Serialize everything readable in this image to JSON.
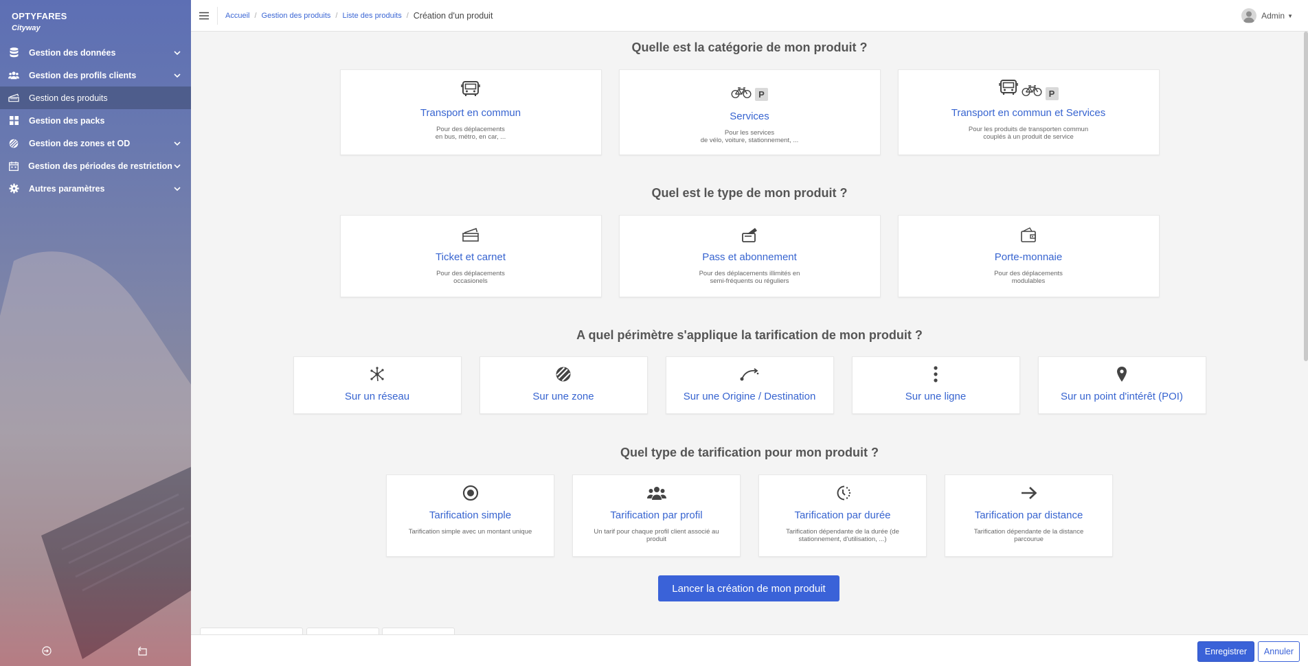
{
  "brand": {
    "name": "OPTYFARES",
    "subtitle": "Cityway"
  },
  "sidebar": {
    "items": [
      {
        "label": "Gestion des données",
        "icon": "database-icon",
        "expandable": true
      },
      {
        "label": "Gestion des profils clients",
        "icon": "users-icon",
        "expandable": true
      },
      {
        "label": "Gestion des produits",
        "icon": "tickets-icon",
        "expandable": false,
        "active": true
      },
      {
        "label": "Gestion des packs",
        "icon": "grid-icon",
        "expandable": false
      },
      {
        "label": "Gestion des zones et OD",
        "icon": "zone-icon",
        "expandable": true
      },
      {
        "label": "Gestion des périodes de restriction",
        "icon": "calendar-icon",
        "expandable": true
      },
      {
        "label": "Autres paramètres",
        "icon": "gear-icon",
        "expandable": true
      }
    ],
    "bottom_icons": [
      "logout-icon",
      "switch-icon"
    ]
  },
  "breadcrumb": {
    "items": [
      "Accueil",
      "Gestion des produits",
      "Liste des produits"
    ],
    "current": "Création d'un produit"
  },
  "user": {
    "name": "Admin"
  },
  "sections": {
    "category": {
      "title": "Quelle est la catégorie de mon produit ?",
      "cards": [
        {
          "title": "Transport en commun",
          "desc": "Pour des déplacements\nen bus, métro, en car, ..."
        },
        {
          "title": "Services",
          "desc": "Pour les services\nde vélo, voiture, stationnement, ..."
        },
        {
          "title": "Transport en commun et Services",
          "desc": "Pour les produits de transporten commun\ncouplés à un produit de service"
        }
      ]
    },
    "type": {
      "title": "Quel est le type de mon produit ?",
      "cards": [
        {
          "title": "Ticket et carnet",
          "desc": "Pour des déplacements\noccasionels"
        },
        {
          "title": "Pass et abonnement",
          "desc": "Pour des déplacements illimités en\nsemi-fréquents ou réguliers"
        },
        {
          "title": "Porte-monnaie",
          "desc": "Pour des déplacements\nmodulables"
        }
      ]
    },
    "scope": {
      "title": "A quel périmètre s'applique la tarification de mon produit ?",
      "cards": [
        {
          "title": "Sur un réseau"
        },
        {
          "title": "Sur une zone"
        },
        {
          "title": "Sur une Origine / Destination"
        },
        {
          "title": "Sur une ligne"
        },
        {
          "title": "Sur un point d'intérêt (POI)"
        }
      ]
    },
    "pricing": {
      "title": "Quel type de tarification pour mon produit ?",
      "cards": [
        {
          "title": "Tarification simple",
          "desc": "Tarification simple avec un montant unique"
        },
        {
          "title": "Tarification par profil",
          "desc": "Un tarif pour chaque profil client associé au\nproduit"
        },
        {
          "title": "Tarification par durée",
          "desc": "Tarification dépendante de la durée (de\nstationnement, d'utilisation, ...)"
        },
        {
          "title": "Tarification par distance",
          "desc": "Tarification dépendante de la distance\nparcourue"
        }
      ]
    }
  },
  "parking_badge": "P",
  "cta": {
    "label": "Lancer la création de mon produit"
  },
  "footer": {
    "save_label": "Enregistrer",
    "cancel_label": "Annuler"
  },
  "colors": {
    "accent": "#3a62d8",
    "link": "#3764d0",
    "sidebar_top": "#5d6fb4",
    "sidebar_bottom": "#a55460"
  }
}
